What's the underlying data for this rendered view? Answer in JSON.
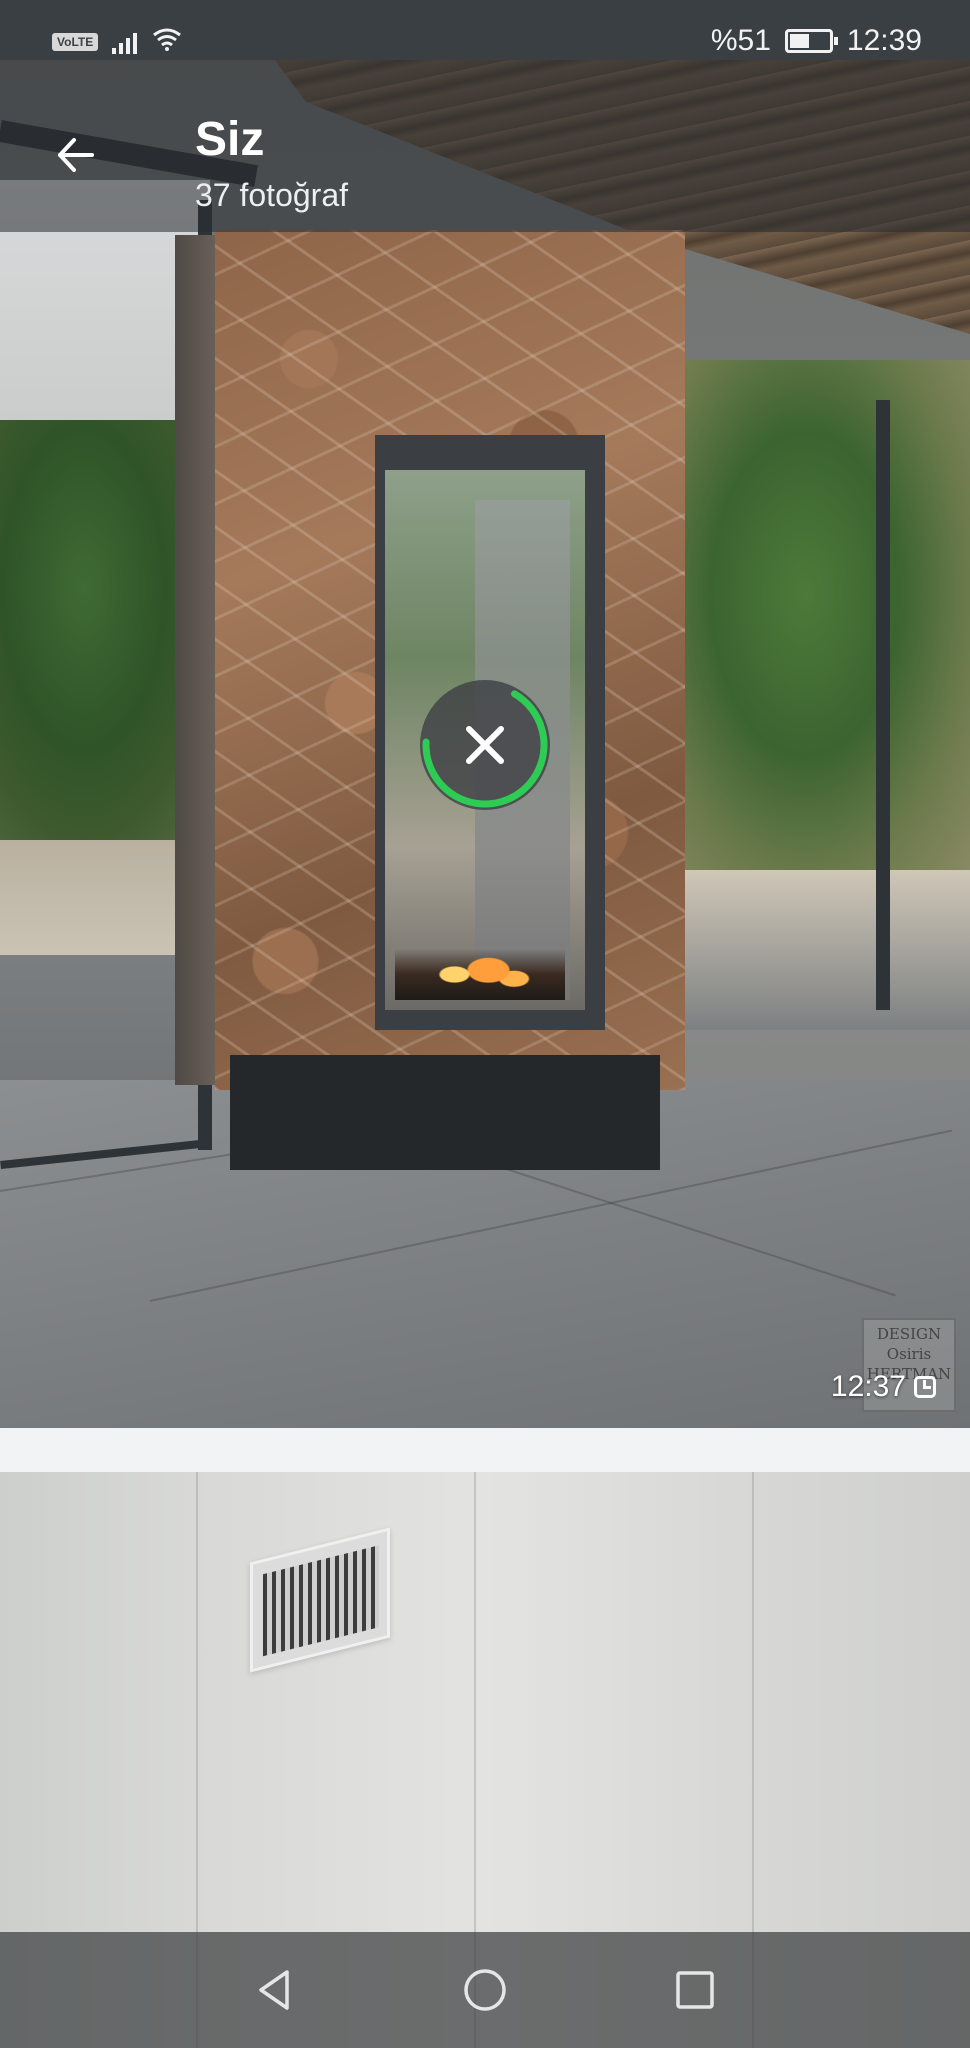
{
  "status_bar": {
    "volte": "VoLTE",
    "battery_percent": "%51",
    "battery_level": 0.51,
    "time": "12:39",
    "icons": [
      "signal-icon",
      "wifi-icon",
      "battery-icon"
    ]
  },
  "toolbar": {
    "title": "Siz",
    "subtitle": "37 fotoğraf",
    "back_icon": "arrow-left-icon"
  },
  "media": {
    "photo1": {
      "time": "12:37",
      "download_icon": "close-icon",
      "watermark": "DESIGN Osiris HERTMAN"
    }
  },
  "nav_bar": {
    "icons": [
      "back-triangle-icon",
      "home-circle-icon",
      "recents-square-icon"
    ]
  },
  "colors": {
    "progress": "#2ecc55",
    "status_bar_bg": "#3a3f44"
  }
}
